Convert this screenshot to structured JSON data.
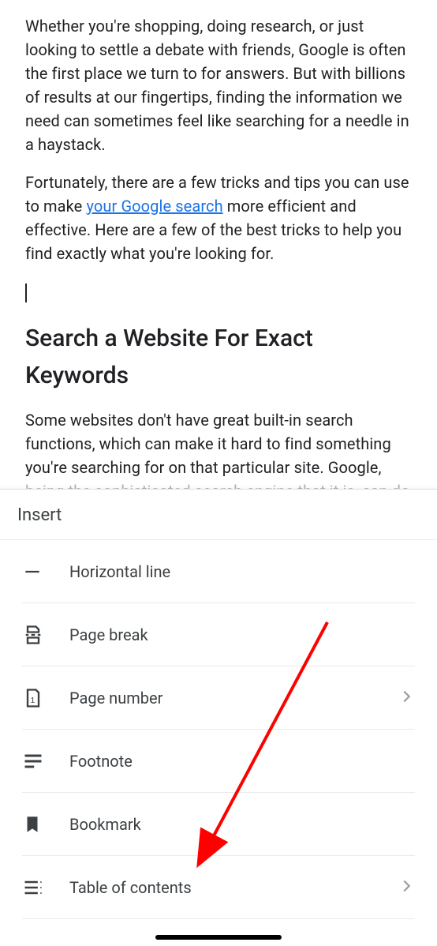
{
  "document": {
    "para1": "Whether you're shopping, doing research, or just looking to settle a debate with friends, Google is often the first place we turn to for answers. But with billions of results at our fingertips, finding the information we need can sometimes feel like searching for a needle in a haystack.",
    "para2_before": "Fortunately, there are a few tricks and tips you can use to make ",
    "para2_link": "your Google search",
    "para2_after": " more efficient and effective. Here are a few of the best tricks to help you find exactly what you're looking for.",
    "heading": "Search a Website For Exact Keywords",
    "para3_visible": "Some websites don't have great built-in search functions, which can make it hard to find something you're searching for on that particular site. Google, ",
    "para3_faded": "being the sophisticated search engine that it is, can do"
  },
  "sheet": {
    "title": "Insert",
    "items": [
      {
        "label": "Horizontal line",
        "icon": "horizontal-line",
        "has_chevron": false
      },
      {
        "label": "Page break",
        "icon": "page-break",
        "has_chevron": false
      },
      {
        "label": "Page number",
        "icon": "page-number",
        "has_chevron": true
      },
      {
        "label": "Footnote",
        "icon": "footnote",
        "has_chevron": false
      },
      {
        "label": "Bookmark",
        "icon": "bookmark",
        "has_chevron": false
      },
      {
        "label": "Table of contents",
        "icon": "toc",
        "has_chevron": true
      }
    ]
  },
  "annotation": {
    "arrow_color": "#ff0000"
  }
}
